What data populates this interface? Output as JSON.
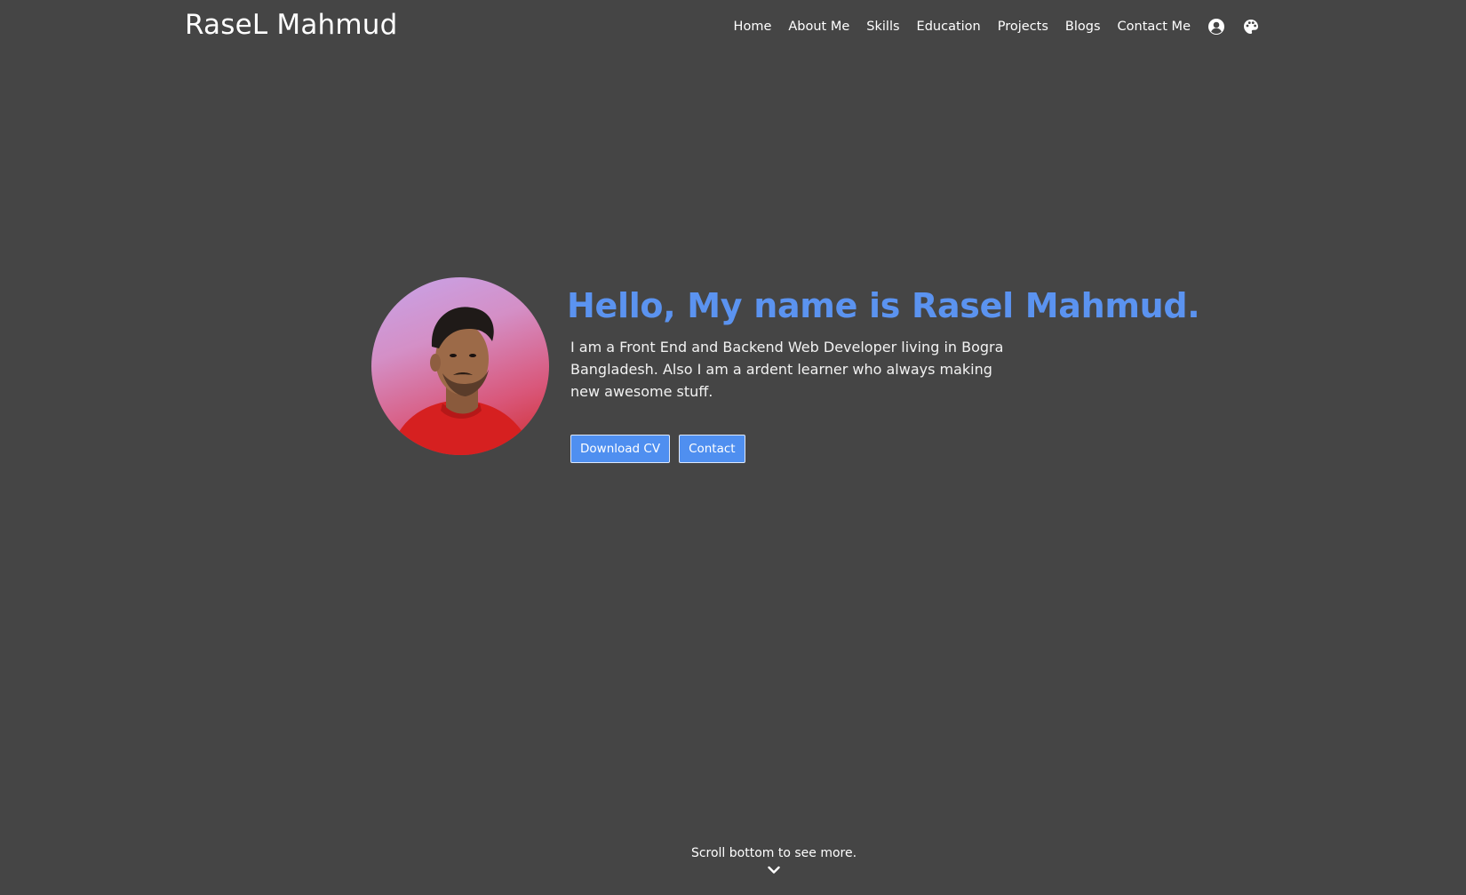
{
  "header": {
    "brand": "RaseL Mahmud",
    "nav": [
      {
        "label": "Home"
      },
      {
        "label": "About Me"
      },
      {
        "label": "Skills"
      },
      {
        "label": "Education"
      },
      {
        "label": "Projects"
      },
      {
        "label": "Blogs"
      },
      {
        "label": "Contact Me"
      }
    ],
    "icons": [
      "user-circle-icon",
      "palette-icon"
    ]
  },
  "hero": {
    "headline": "Hello, My name is Rasel Mahmud.",
    "bio": "I am a Front End and Backend Web Developer living in Bogra Bangladesh. Also I am a ardent learner who always making new awesome stuff.",
    "buttons": {
      "download_cv": "Download CV",
      "contact": "Contact"
    }
  },
  "footer_hint": {
    "text": "Scroll bottom to see more.",
    "icon": "chevron-down-icon"
  },
  "colors": {
    "background": "#454545",
    "accent": "#5b93f0",
    "button": "#4f8ff0"
  }
}
